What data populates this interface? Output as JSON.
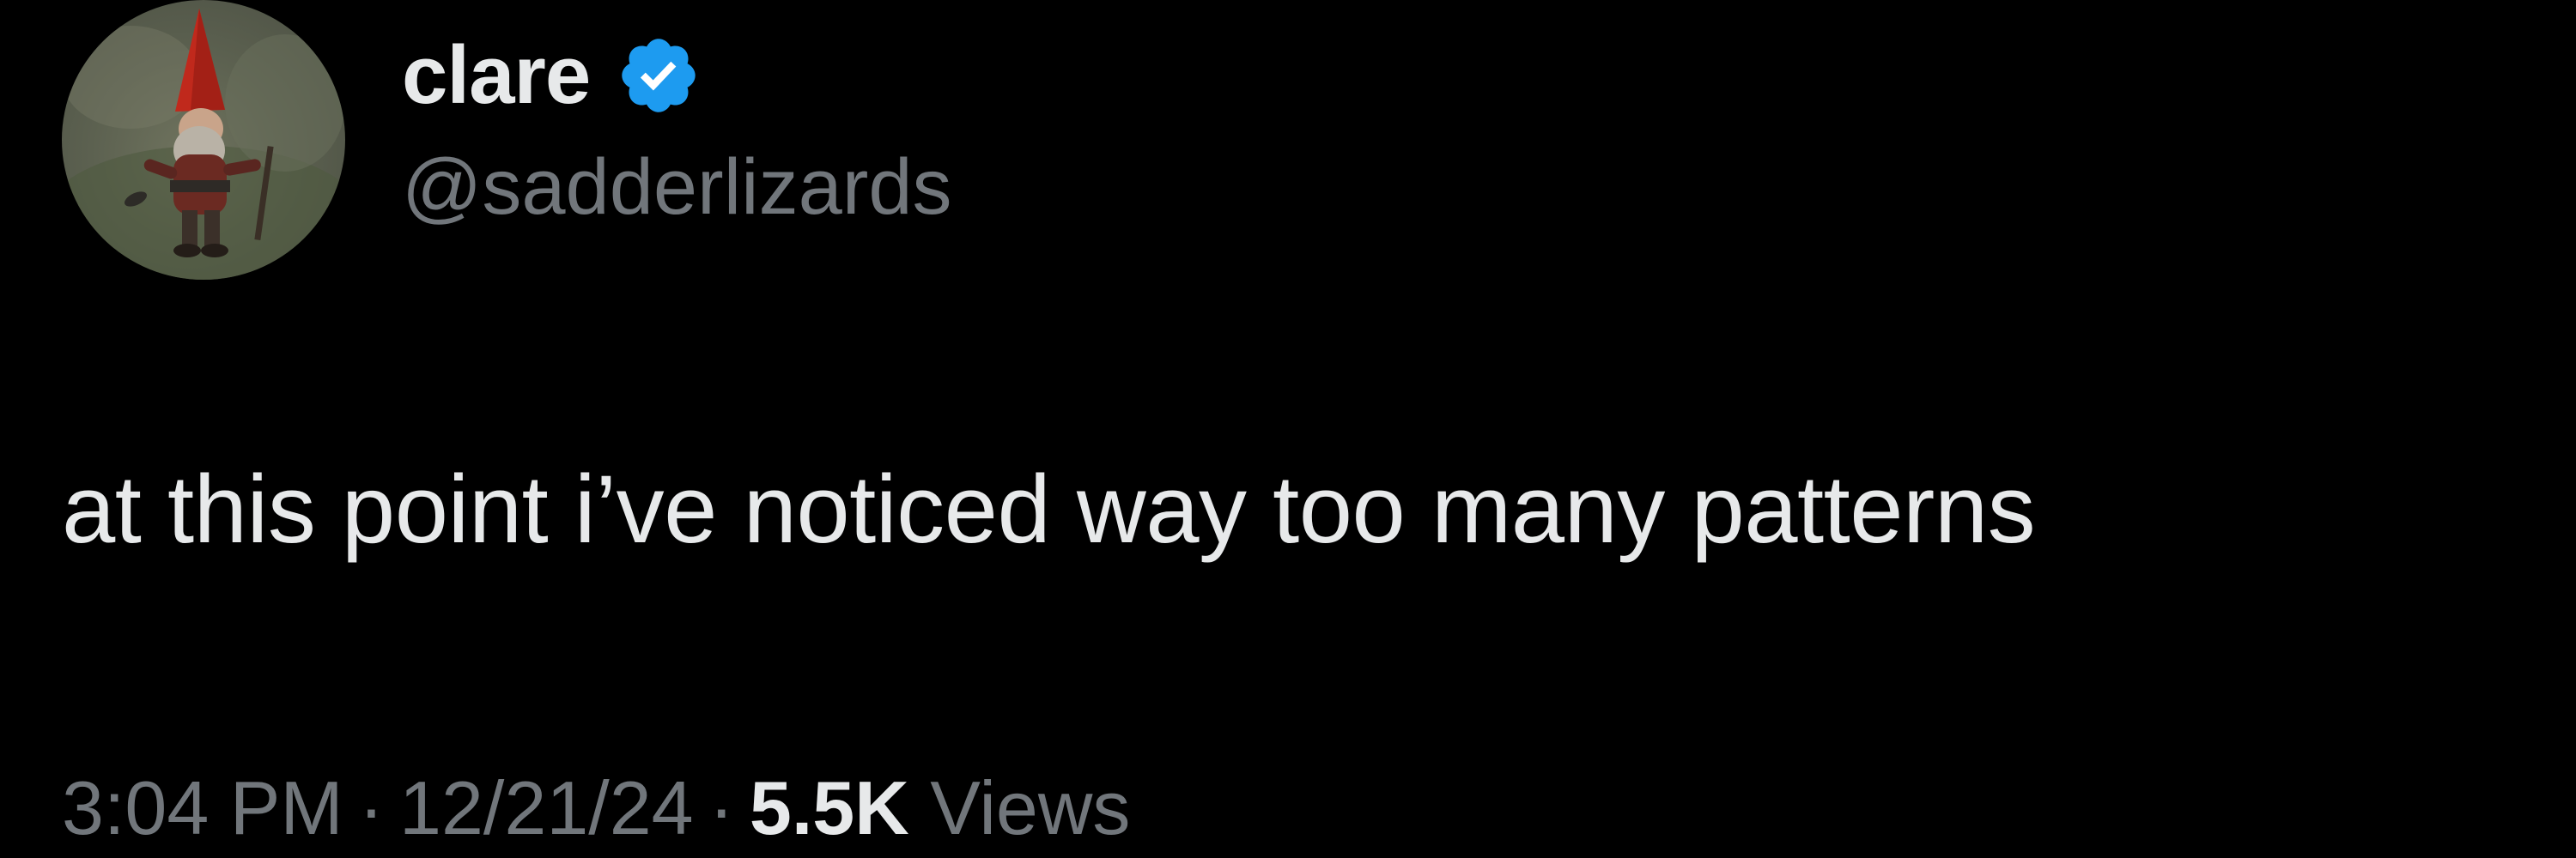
{
  "author": {
    "display_name": "clare",
    "handle": "@sadderlizards",
    "verified": true,
    "avatar_icon": "gnome-avatar-icon",
    "verified_icon": "verified-badge-icon",
    "verified_color": "#1d9bf0"
  },
  "tweet": {
    "text": "at this point i’ve noticed way too many patterns"
  },
  "meta": {
    "time": "3:04 PM",
    "separator": "·",
    "date": "12/21/24",
    "view_count": "5.5K",
    "views_label": "Views"
  },
  "colors": {
    "background": "#000000",
    "primary_text": "#e7e9ea",
    "secondary_text": "#71767b"
  }
}
